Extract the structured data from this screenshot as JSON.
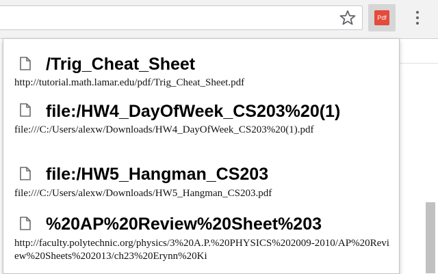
{
  "toolbar": {
    "bookmark_icon": "star-icon",
    "extension_icon_label": "Pdf",
    "menu_icon": "vertical-dots-icon"
  },
  "entries": [
    {
      "title": "/Trig_Cheat_Sheet",
      "url": "http://tutorial.math.lamar.edu/pdf/Trig_Cheat_Sheet.pdf"
    },
    {
      "title": "file:/HW4_DayOfWeek_CS203%20(1)",
      "url": "file:///C:/Users/alexw/Downloads/HW4_DayOfWeek_CS203%20(1).pdf"
    },
    {
      "title": "file:/HW5_Hangman_CS203",
      "url": "file:///C:/Users/alexw/Downloads/HW5_Hangman_CS203.pdf"
    },
    {
      "title": "%20AP%20Review%20Sheet%203",
      "url": "http://faculty.polytechnic.org/physics/3%20A.P.%20PHYSICS%202009-2010/AP%20Review%20Sheets%202013/ch23%20Erynn%20Ki"
    }
  ]
}
